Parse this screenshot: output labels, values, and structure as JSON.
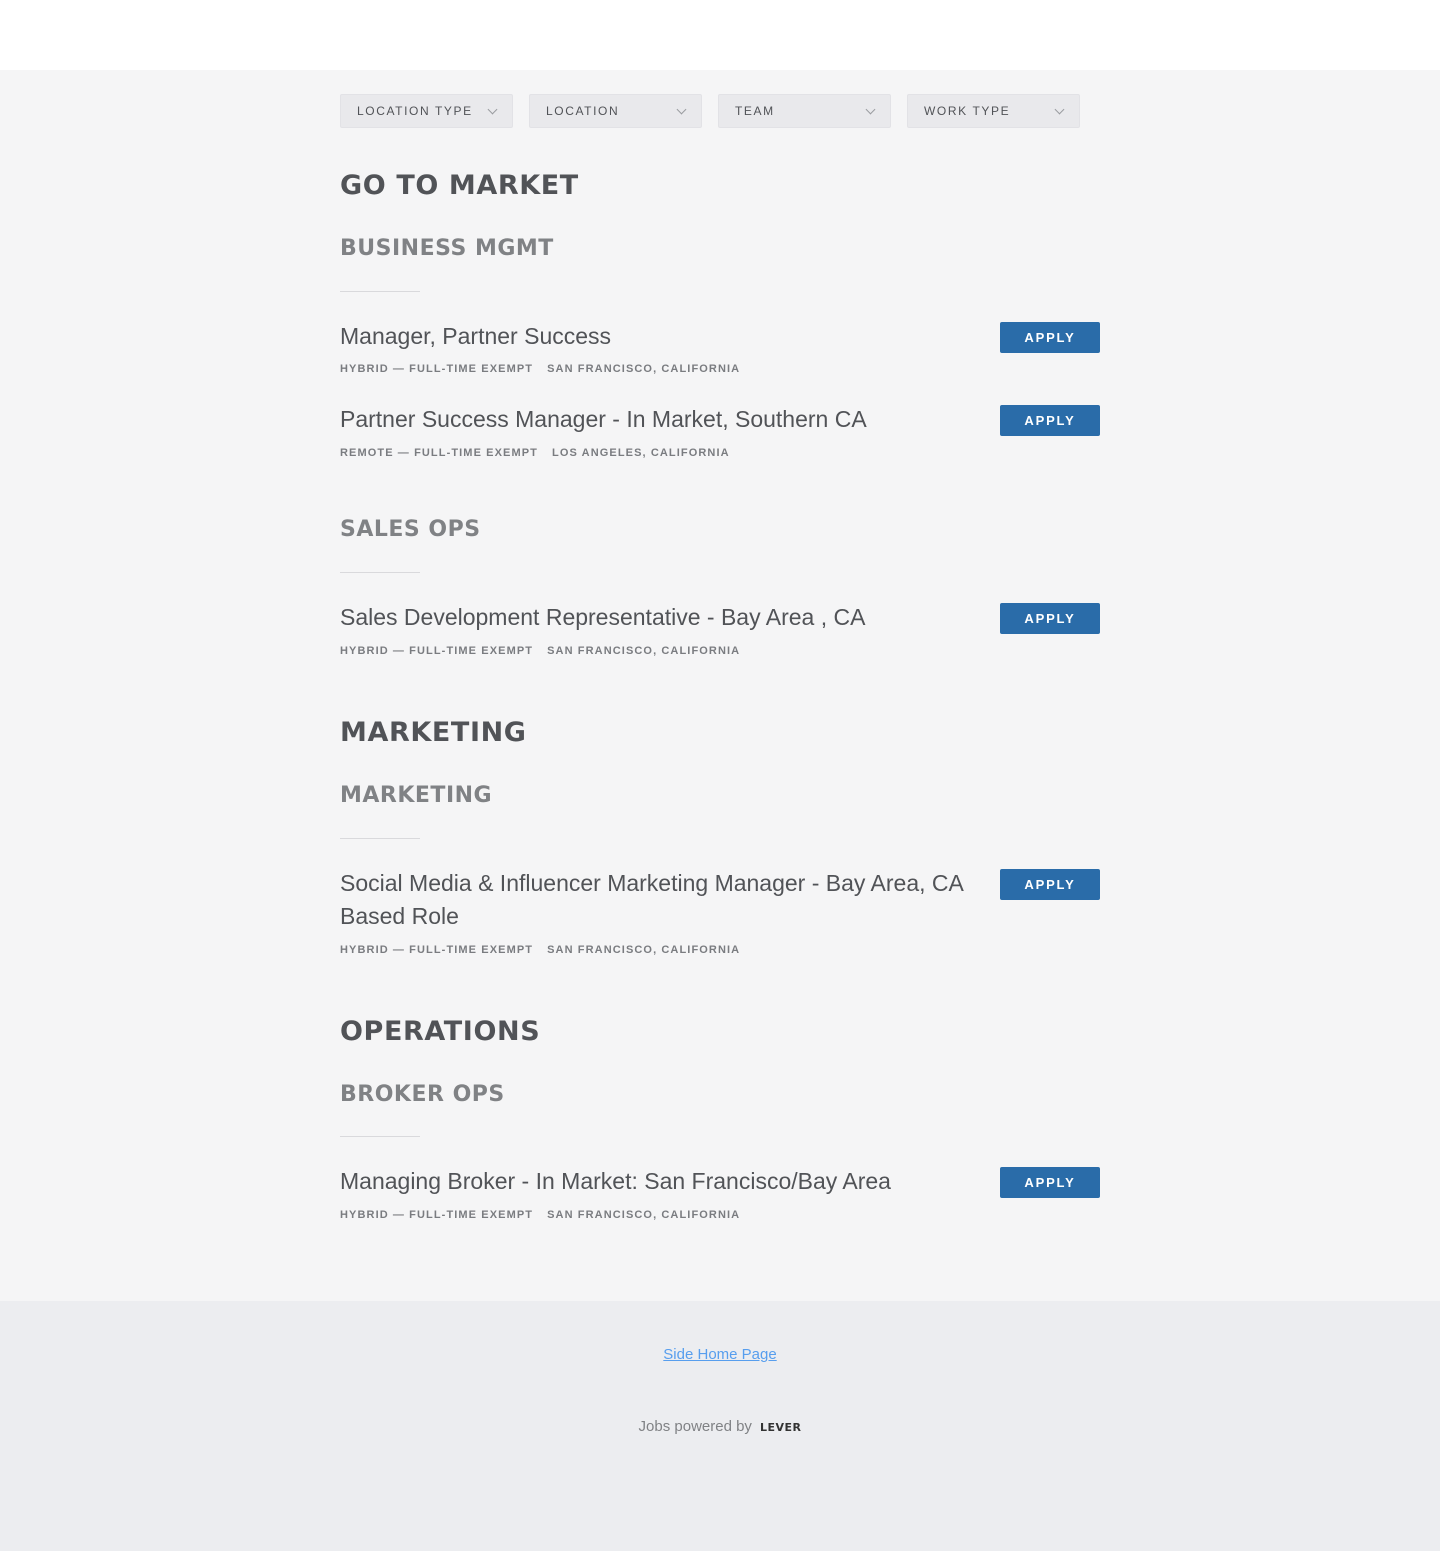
{
  "filters": [
    {
      "label": "LOCATION TYPE"
    },
    {
      "label": "LOCATION"
    },
    {
      "label": "TEAM"
    },
    {
      "label": "WORK TYPE"
    }
  ],
  "departments": [
    {
      "name": "GO TO MARKET",
      "teams": [
        {
          "name": "BUSINESS MGMT",
          "jobs": [
            {
              "title": "Manager, Partner Success",
              "type": "HYBRID — FULL-TIME EXEMPT",
              "location": "SAN FRANCISCO, CALIFORNIA",
              "apply": "APPLY"
            },
            {
              "title": "Partner Success Manager - In Market, Southern CA",
              "type": "REMOTE — FULL-TIME EXEMPT",
              "location": "LOS ANGELES, CALIFORNIA",
              "apply": "APPLY"
            }
          ]
        },
        {
          "name": "SALES OPS",
          "jobs": [
            {
              "title": "Sales Development Representative - Bay Area , CA",
              "type": "HYBRID — FULL-TIME EXEMPT",
              "location": "SAN FRANCISCO, CALIFORNIA",
              "apply": "APPLY"
            }
          ]
        }
      ]
    },
    {
      "name": "MARKETING",
      "teams": [
        {
          "name": "MARKETING",
          "jobs": [
            {
              "title": "Social Media & Influencer Marketing Manager - Bay Area, CA Based Role",
              "type": "HYBRID — FULL-TIME EXEMPT",
              "location": "SAN FRANCISCO, CALIFORNIA",
              "apply": "APPLY"
            }
          ]
        }
      ]
    },
    {
      "name": "OPERATIONS",
      "teams": [
        {
          "name": "BROKER OPS",
          "jobs": [
            {
              "title": "Managing Broker - In Market: San Francisco/Bay Area",
              "type": "HYBRID — FULL-TIME EXEMPT",
              "location": "SAN FRANCISCO, CALIFORNIA",
              "apply": "APPLY"
            }
          ]
        }
      ]
    }
  ],
  "footer": {
    "home_link": "Side Home Page",
    "powered_by": "Jobs powered by",
    "brand": "LEVER"
  }
}
